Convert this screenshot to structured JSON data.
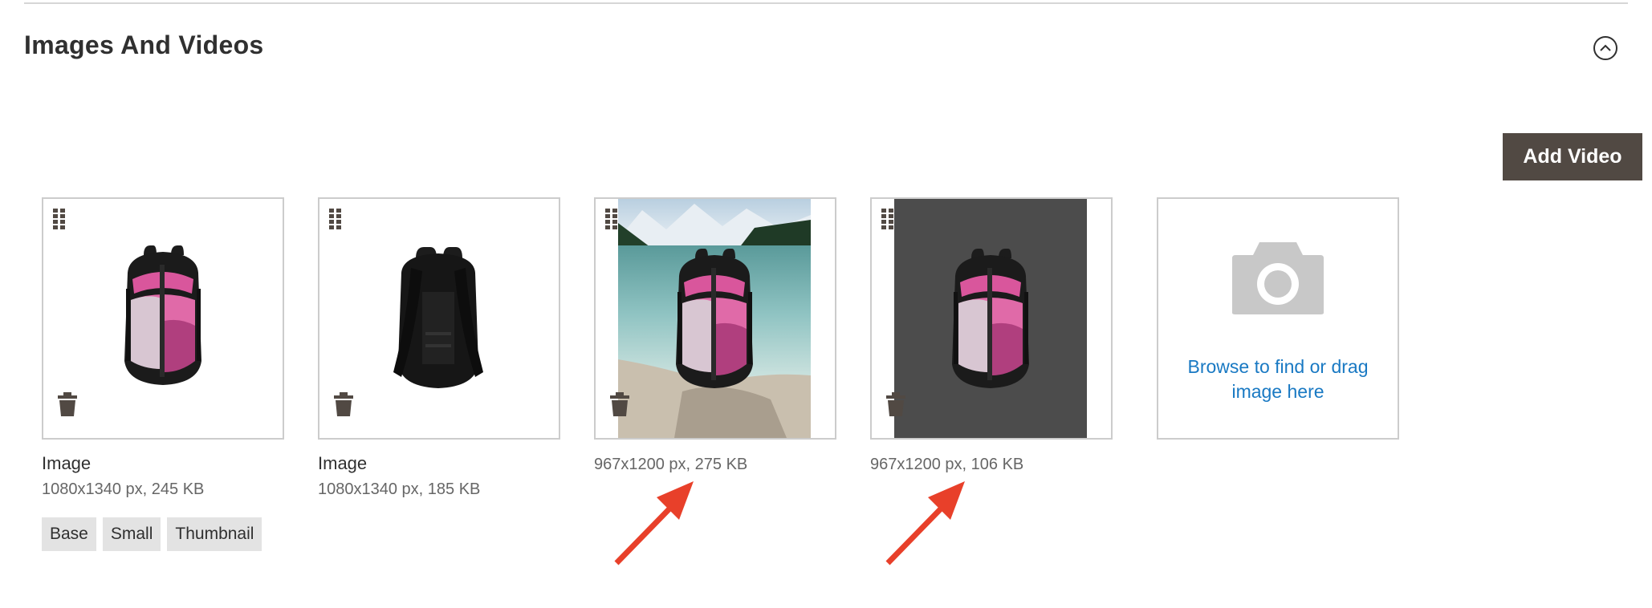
{
  "section": {
    "title": "Images And Videos"
  },
  "toolbar": {
    "add_video_label": "Add Video"
  },
  "images": [
    {
      "caption": "Image",
      "meta": "1080x1340 px, 245 KB",
      "icon": "backpack-front-icon"
    },
    {
      "caption": "Image",
      "meta": "1080x1340 px, 185 KB",
      "icon": "backpack-back-icon"
    },
    {
      "caption": "",
      "meta": "967x1200 px, 275 KB",
      "icon": "backpack-lake-icon"
    },
    {
      "caption": "",
      "meta": "967x1200 px, 106 KB",
      "icon": "backpack-dark-bg-icon"
    }
  ],
  "roles": [
    "Base",
    "Small",
    "Thumbnail"
  ],
  "uploader": {
    "label": "Browse to find or drag image here",
    "icon": "camera-icon"
  },
  "colors": {
    "accent_button": "#514943",
    "link": "#1979c3",
    "annotation_arrow": "#e8402a",
    "card_border": "#cccccc",
    "tag_background": "#e3e3e3"
  }
}
